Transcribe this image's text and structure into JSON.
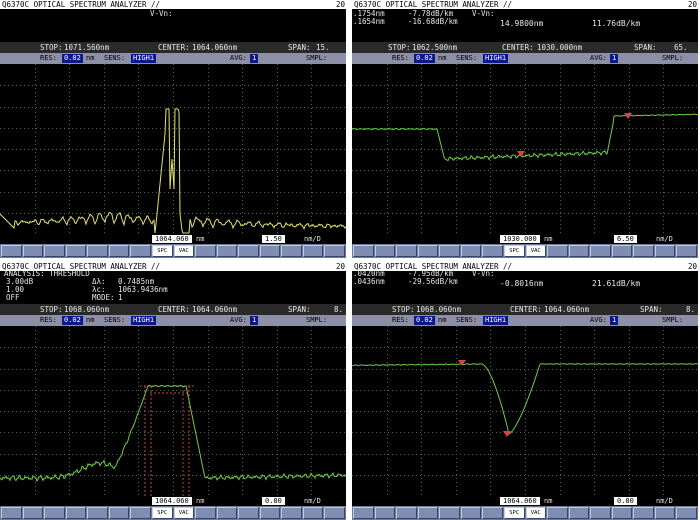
{
  "panels": [
    {
      "header": {
        "title": "Q6370C OPTICAL SPECTRUM ANALYZER //",
        "page_mark": "20"
      },
      "info": {
        "line1_label": "V-Vn:",
        "line1": "",
        "line2": "",
        "line3": ""
      },
      "stop_label": "STOP:",
      "stop": "1071.560nm",
      "center_label": "CENTER:",
      "center": "1064.060nm",
      "span_label": "SPAN:",
      "span": "15.",
      "res_label": "RES:",
      "res": "0.02",
      "res_unit": "nm",
      "sens_label": "SENS:",
      "sens": "HIGH1",
      "avg_label": "AVG:",
      "avg": "1",
      "smpl_label": "SMPL:",
      "marker": "1064.060",
      "marker_unit": "nm",
      "scale": "1.50",
      "scale_unit": "nm/D",
      "trace_color": "#e4e070"
    },
    {
      "header": {
        "title": "Q6370C OPTICAL SPECTRUM ANALYZER //",
        "page_mark": "20"
      },
      "info": {
        "l1a": ".1754nm",
        "l1b": "-7.78dB/km",
        "l1c": "V-Vn:",
        "l2a": ".1654nm",
        "l2b": "-16.68dB/km",
        "l2c": "14.9800nm",
        "l2d": "11.76dB/km"
      },
      "stop_label": "STOP:",
      "stop": "1062.500nm",
      "center_label": "CENTER:",
      "center": "1030.000nm",
      "span_label": "SPAN:",
      "span": "65.",
      "res_label": "RES:",
      "res": "0.02",
      "res_unit": "nm",
      "sens_label": "SENS:",
      "sens": "HIGH1",
      "avg_label": "AVG:",
      "avg": "1",
      "smpl_label": "SMPL:",
      "marker": "1030.000",
      "marker_unit": "nm",
      "scale": "6.50",
      "scale_unit": "nm/D",
      "trace_color": "#6ecc4a"
    },
    {
      "header": {
        "title": "Q6370C OPTICAL SPECTRUM ANALYZER //",
        "page_mark": "20"
      },
      "info": {
        "l1": "ANALYSIS: THRESHOLD",
        "l2a": "3.00dB",
        "l2b": "Δλ:",
        "l2c": "0.7485nm",
        "l3a": "1.00",
        "l3b": "λc:",
        "l3c": "1063.9436nm",
        "l4a": "OFF",
        "l4b": "MODE:",
        "l4c": "1"
      },
      "stop_label": "STOP:",
      "stop": "1068.060nm",
      "center_label": "CENTER:",
      "center": "1064.060nm",
      "span_label": "SPAN:",
      "span": "8.",
      "res_label": "RES:",
      "res": "0.02",
      "res_unit": "nm",
      "sens_label": "SENS:",
      "sens": "HIGH1",
      "avg_label": "AVG:",
      "avg": "1",
      "smpl_label": "SMPL:",
      "marker": "1064.060",
      "marker_unit": "nm",
      "scale": "0.80",
      "scale_unit": "nm/D",
      "trace_color": "#6ecc4a"
    },
    {
      "header": {
        "title": "Q6370C OPTICAL SPECTRUM ANALYZER //",
        "page_mark": "20"
      },
      "info": {
        "l1a": ".0420nm",
        "l1b": "-7.95dB/km",
        "l1c": "V-Vn:",
        "l2a": ".0436nm",
        "l2b": "-29.56dB/km",
        "l2c": "-0.8016nm",
        "l2d": "21.61dB/km"
      },
      "stop_label": "STOP:",
      "stop": "1068.060nm",
      "center_label": "CENTER:",
      "center": "1064.060nm",
      "span_label": "SPAN:",
      "span": "8.",
      "res_label": "RES:",
      "res": "0.02",
      "res_unit": "nm",
      "sens_label": "SENS:",
      "sens": "HIGH1",
      "avg_label": "AVG:",
      "avg": "1",
      "smpl_label": "SMPL:",
      "marker": "1064.060",
      "marker_unit": "nm",
      "scale": "0.80",
      "scale_unit": "nm/D",
      "trace_color": "#6ecc4a"
    }
  ],
  "softkey_active_label": "SPC",
  "softkey_active_label_2": "VAC",
  "colors": {
    "screen": "#000000",
    "grid": "#3a6e3a",
    "marker": "#e04040",
    "threshold": "#d04040"
  }
}
